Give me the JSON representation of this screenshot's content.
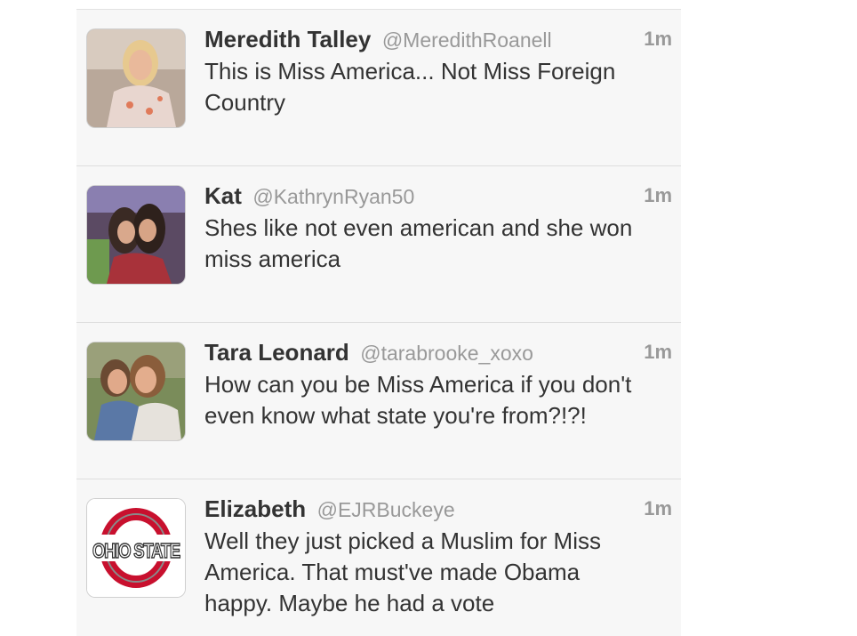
{
  "tweets": [
    {
      "name": "Meredith Talley",
      "handle": "@MeredithRoanell",
      "time": "1m",
      "text": "This is Miss America... Not Miss Foreign Country"
    },
    {
      "name": "Kat",
      "handle": "@KathrynRyan50",
      "time": "1m",
      "text": "Shes like not even american and she won miss america"
    },
    {
      "name": "Tara Leonard",
      "handle": "@tarabrooke_xoxo",
      "time": "1m",
      "text": "How can you be Miss America if you don't even know what state you're from?!?!"
    },
    {
      "name": "Elizabeth",
      "handle": "@EJRBuckeye",
      "time": "1m",
      "text": "Well they just picked a Muslim for Miss America. That must've made Obama happy. Maybe he had a vote",
      "avatar_logo_text": "OHIO STATE"
    }
  ],
  "colors": {
    "background": "#f7f7f7",
    "name": "#333333",
    "handle": "#999999",
    "logo_red": "#c8102e"
  }
}
